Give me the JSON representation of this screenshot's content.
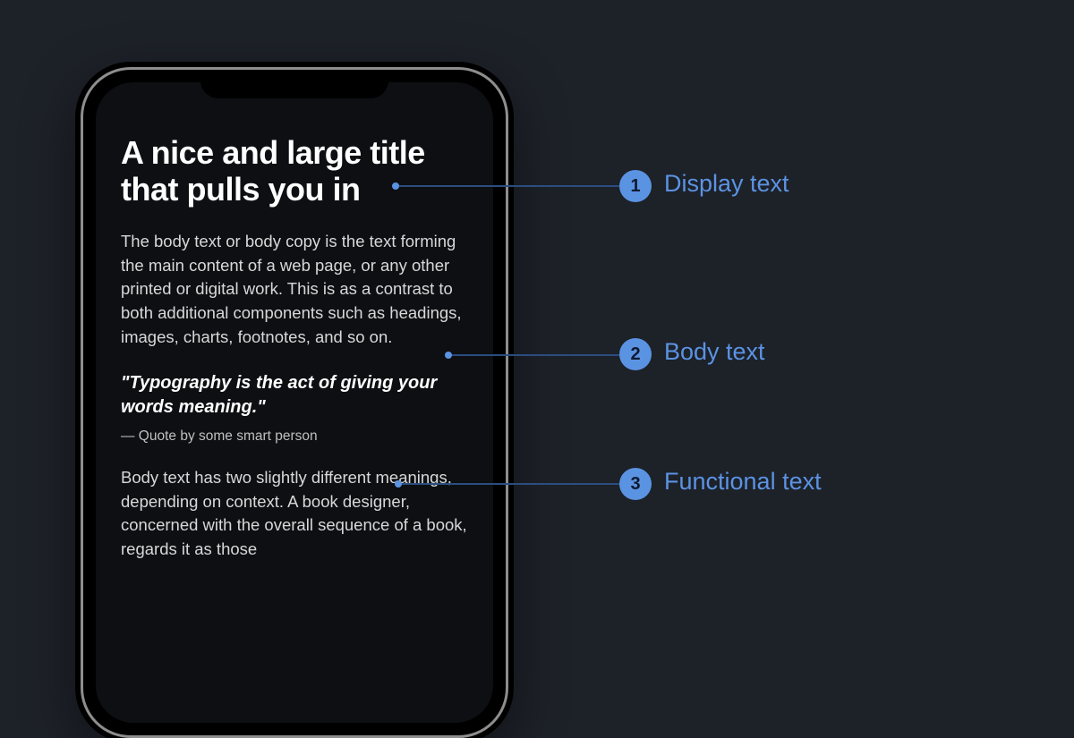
{
  "phone": {
    "title": "A nice and large title that pulls you in",
    "body1": "The body text or body copy is the text forming the main content of a web page, or any other printed or digital work. This is as a contrast to both additional components such as headings, images, charts, footnotes, and so on.",
    "quote": "\"Typography is the act of giving  your words meaning.\"",
    "attribution": "— Quote by some smart person",
    "body2": "Body text has two slightly different meanings, depending on context. A book designer, concerned with the overall sequence of a book, regards it as those"
  },
  "annotations": [
    {
      "num": "1",
      "label": "Display text"
    },
    {
      "num": "2",
      "label": "Body text"
    },
    {
      "num": "3",
      "label": "Functional text"
    }
  ]
}
